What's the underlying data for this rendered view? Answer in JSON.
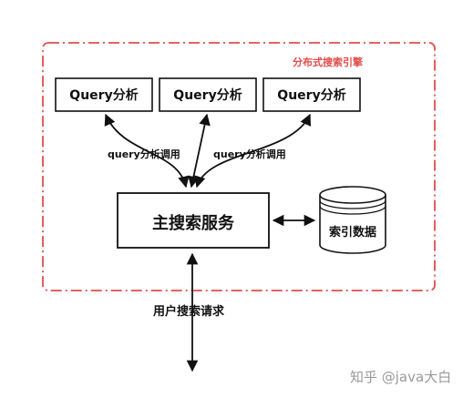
{
  "region_label": "分布式搜索引擎",
  "query_boxes": [
    {
      "label": "Query分析"
    },
    {
      "label": "Query分析"
    },
    {
      "label": "Query分析"
    }
  ],
  "edge_labels": {
    "left": "query分析调用",
    "right": "query分析调用"
  },
  "main_service": {
    "label": "主搜索服务"
  },
  "index_store": {
    "label": "索引数据"
  },
  "user_request": {
    "label": "用户搜索请求"
  },
  "watermark": "知乎 @java大白",
  "colors": {
    "region_border": "#e34b4b",
    "box_border": "#111111",
    "watermark": "#9a9a9a"
  }
}
